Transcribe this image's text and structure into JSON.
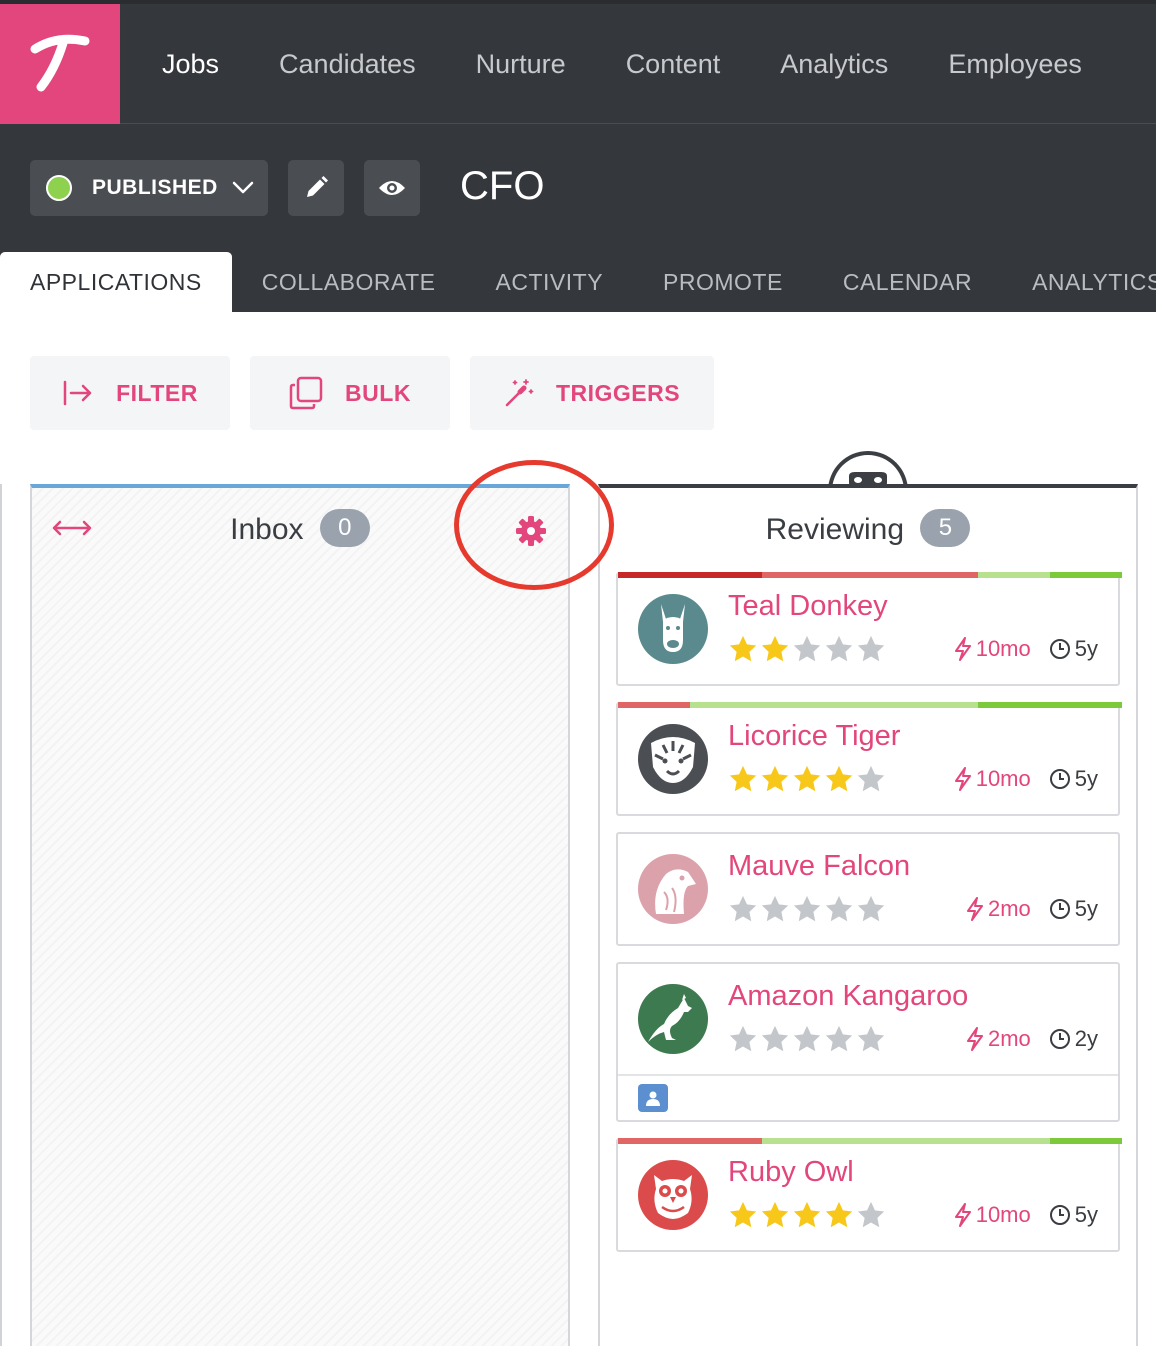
{
  "nav": {
    "items": [
      {
        "label": "Jobs",
        "active": true
      },
      {
        "label": "Candidates",
        "active": false
      },
      {
        "label": "Nurture",
        "active": false
      },
      {
        "label": "Content",
        "active": false
      },
      {
        "label": "Analytics",
        "active": false
      },
      {
        "label": "Employees",
        "active": false
      }
    ]
  },
  "job": {
    "status_label": "PUBLISHED",
    "status_color": "#8dd14e",
    "title": "CFO"
  },
  "tabs": [
    {
      "label": "APPLICATIONS",
      "active": true
    },
    {
      "label": "COLLABORATE",
      "active": false
    },
    {
      "label": "ACTIVITY",
      "active": false
    },
    {
      "label": "PROMOTE",
      "active": false
    },
    {
      "label": "CALENDAR",
      "active": false
    },
    {
      "label": "ANALYTICS",
      "active": false
    }
  ],
  "actions": {
    "filter_label": "FILTER",
    "bulk_label": "BULK",
    "triggers_label": "TRIGGERS"
  },
  "columns": {
    "inbox": {
      "title": "Inbox",
      "count": "0"
    },
    "reviewing": {
      "title": "Reviewing",
      "count": "5"
    }
  },
  "candidates": [
    {
      "name": "Teal Donkey",
      "rating": 2,
      "activity": "10mo",
      "age": "5y",
      "avatar": "donkey-icon",
      "avatar_color": "#5a8a8e"
    },
    {
      "name": "Licorice Tiger",
      "rating": 4,
      "activity": "10mo",
      "age": "5y",
      "avatar": "tiger-icon",
      "avatar_color": "#4b4e53"
    },
    {
      "name": "Mauve Falcon",
      "rating": 0,
      "activity": "2mo",
      "age": "5y",
      "avatar": "falcon-icon",
      "avatar_color": "#dca2ab"
    },
    {
      "name": "Amazon Kangaroo",
      "rating": 0,
      "activity": "2mo",
      "age": "2y",
      "avatar": "kangaroo-icon",
      "avatar_color": "#3e7a4f"
    },
    {
      "name": "Ruby Owl",
      "rating": 4,
      "activity": "10mo",
      "age": "5y",
      "avatar": "owl-icon",
      "avatar_color": "#dc4b4b"
    }
  ],
  "colors": {
    "brand": "#e2467c",
    "topbar": "#34373c",
    "star_filled": "#f7c719",
    "star_empty": "#c3c6ca",
    "annotation_ring": "#e63a2e"
  }
}
